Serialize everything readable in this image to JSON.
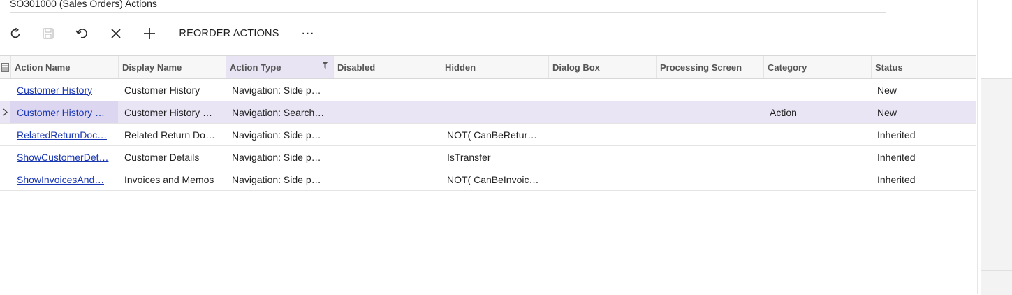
{
  "window": {
    "title": "SO301000 (Sales Orders) Actions"
  },
  "toolbar": {
    "refresh_icon": "refresh-icon",
    "save_icon": "save-icon",
    "undo_icon": "undo-icon",
    "delete_icon": "close-icon",
    "add_icon": "plus-icon",
    "reorder_label": "REORDER ACTIONS",
    "more_label": "···"
  },
  "grid": {
    "columns": [
      "Action Name",
      "Display Name",
      "Action Type",
      "Disabled",
      "Hidden",
      "Dialog Box",
      "Processing Screen",
      "Category",
      "Status"
    ],
    "sorted_column": "Action Type",
    "rows": [
      {
        "action_name": "Customer History",
        "display_name": "Customer History",
        "action_type": "Navigation: Side p…",
        "disabled": "",
        "hidden": "",
        "dialog_box": "",
        "processing_screen": "",
        "category": "",
        "status": "New",
        "selected": false
      },
      {
        "action_name": "Customer History …",
        "display_name": "Customer History …",
        "action_type": "Navigation: Search…",
        "disabled": "",
        "hidden": "",
        "dialog_box": "",
        "processing_screen": "",
        "category": "Action",
        "status": "New",
        "selected": true
      },
      {
        "action_name": "RelatedReturnDoc…",
        "display_name": "Related Return Do…",
        "action_type": "Navigation: Side p…",
        "disabled": "",
        "hidden": "NOT( CanBeRetur…",
        "dialog_box": "",
        "processing_screen": "",
        "category": "",
        "status": "Inherited",
        "selected": false
      },
      {
        "action_name": "ShowCustomerDet…",
        "display_name": "Customer Details",
        "action_type": "Navigation: Side p…",
        "disabled": "",
        "hidden": "IsTransfer",
        "dialog_box": "",
        "processing_screen": "",
        "category": "",
        "status": "Inherited",
        "selected": false
      },
      {
        "action_name": "ShowInvoicesAnd…",
        "display_name": "Invoices and Memos",
        "action_type": "Navigation: Side p…",
        "disabled": "",
        "hidden": "NOT( CanBeInvoic…",
        "dialog_box": "",
        "processing_screen": "",
        "category": "",
        "status": "Inherited",
        "selected": false
      }
    ]
  },
  "colors": {
    "link": "#1a37b4",
    "selected_row": "#e9e5f4",
    "header_bg": "#f7f7f7",
    "active_header": "#e8e4f3"
  }
}
